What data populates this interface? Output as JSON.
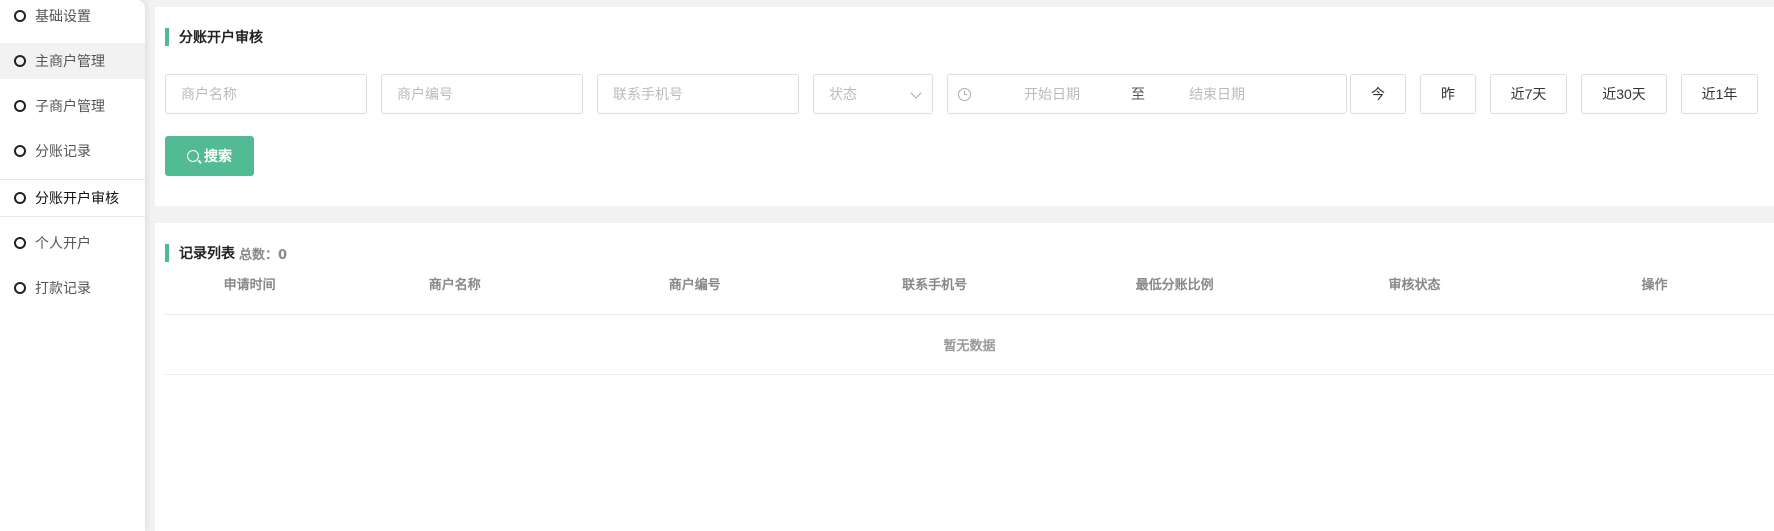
{
  "sidebar": {
    "items": [
      {
        "label": "基础设置"
      },
      {
        "label": "主商户管理"
      },
      {
        "label": "子商户管理"
      },
      {
        "label": "分账记录"
      },
      {
        "label": "分账开户审核"
      },
      {
        "label": "个人开户"
      },
      {
        "label": "打款记录"
      }
    ],
    "active_index": 4
  },
  "filter": {
    "title": "分账开户审核",
    "merchant_name_placeholder": "商户名称",
    "merchant_no_placeholder": "商户编号",
    "phone_placeholder": "联系手机号",
    "status_placeholder": "状态",
    "date_start_placeholder": "开始日期",
    "date_separator": "至",
    "date_end_placeholder": "结束日期",
    "quick": {
      "today": "今",
      "yesterday": "昨",
      "last7": "近7天",
      "last30": "近30天",
      "last_year": "近1年"
    },
    "search_label": "搜索"
  },
  "list": {
    "title": "记录列表",
    "total_label": "总数：",
    "total_count": "0",
    "columns": [
      "申请时间",
      "商户名称",
      "商户编号",
      "联系手机号",
      "最低分账比例",
      "审核状态",
      "操作"
    ],
    "empty_text": "暂无数据"
  },
  "colors": {
    "accent": "#52bb94",
    "page_bg": "#f2f2f2"
  }
}
